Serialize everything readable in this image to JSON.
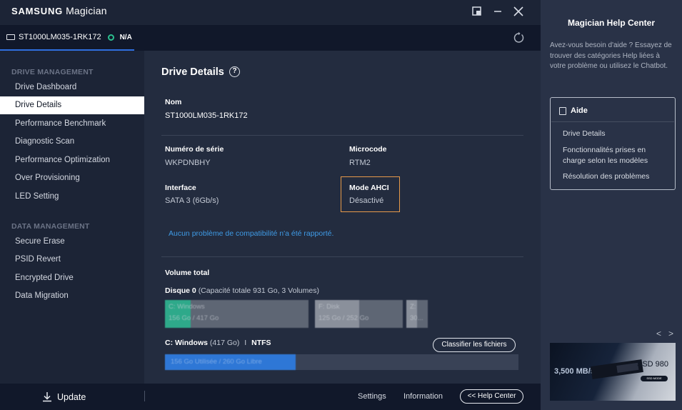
{
  "app": {
    "brand_bold": "SAMSUNG",
    "brand_light": "Magician"
  },
  "device": {
    "name": "ST1000LM035-1RK172",
    "status": "N/A"
  },
  "sidebar": {
    "drive_management_title": "DRIVE MANAGEMENT",
    "drive_items": [
      {
        "label": "Drive Dashboard"
      },
      {
        "label": "Drive Details"
      },
      {
        "label": "Performance Benchmark"
      },
      {
        "label": "Diagnostic Scan"
      },
      {
        "label": "Performance Optimization"
      },
      {
        "label": "Over Provisioning"
      },
      {
        "label": "LED Setting"
      }
    ],
    "data_management_title": "DATA MANAGEMENT",
    "data_items": [
      {
        "label": "Secure Erase"
      },
      {
        "label": "PSID Revert"
      },
      {
        "label": "Encrypted Drive"
      },
      {
        "label": "Data Migration"
      }
    ],
    "active_item": "Drive Details"
  },
  "details": {
    "title": "Drive Details",
    "help_glyph": "?",
    "nom_label": "Nom",
    "nom_value": "ST1000LM035-1RK172",
    "serial_label": "Numéro de série",
    "serial_value": "WKPDNBHY",
    "microcode_label": "Microcode",
    "microcode_value": "RTM2",
    "interface_label": "Interface",
    "interface_value": "SATA 3 (6Gb/s)",
    "ahci_label": "Mode AHCI",
    "ahci_value": "Désactivé",
    "compat_msg": "Aucun problème de compatibilité n'a été rapporté.",
    "volume_title": "Volume total",
    "disk_label": "Disque 0",
    "disk_info": "(Capacité totale 931 Go, 3 Volumes)",
    "segments": [
      {
        "t1": "C: Windows",
        "t2": "156 Go / 417 Go",
        "color": "#2ea98a",
        "used": 0.18
      },
      {
        "t1": "F: Disk",
        "t2": "125 Go / 252 Go",
        "color": "#8a909b",
        "used": 0.5
      },
      {
        "t1": "Z:",
        "t2": "30...",
        "color": "#8a909b",
        "used": 0.5
      }
    ],
    "volume_name": "C: Windows",
    "volume_size": "(417 Go)",
    "volume_sep": "I",
    "volume_fs": "NTFS",
    "classify_button": "Classifier les fichiers",
    "volume_bar_text": "156 Go Utilisée / 260 Go Libre",
    "volume_used": 0.37
  },
  "bottom": {
    "update": "Update",
    "settings": "Settings",
    "information": "Information",
    "help_center": "<< Help Center"
  },
  "help_panel": {
    "title": "Magician Help Center",
    "description": "Avez-vous besoin d'aide ? Essayez de trouver des catégories Help liées à votre problème ou utilisez le Chatbot.",
    "aide_title": "Aide",
    "links": [
      {
        "label": "Drive Details"
      },
      {
        "label": "Fonctionnalités prises en charge selon les modèles"
      },
      {
        "label": "Résolution des problèmes"
      }
    ],
    "prev": "<",
    "next": ">",
    "promo": {
      "speed": "3,500 MB/s",
      "product": "SSD 980",
      "mode": "SSD MODE"
    }
  },
  "colors": {
    "accent": "#2f6fe0",
    "status_ok": "#2bbf8e",
    "highlight": "#e69a4a",
    "link": "#3f9be6"
  }
}
